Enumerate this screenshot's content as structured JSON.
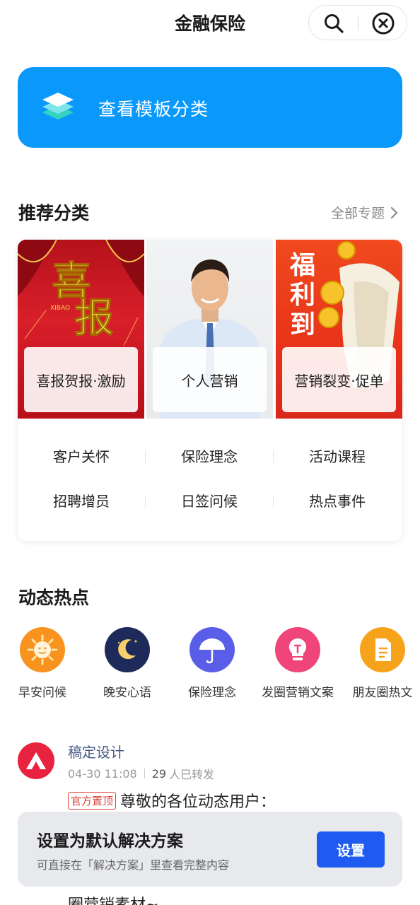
{
  "header": {
    "title": "金融保险",
    "search_icon": "search-icon",
    "close_icon": "close-circle-icon"
  },
  "banner": {
    "label": "查看模板分类",
    "icon": "layers-icon",
    "color": "#0a99fb"
  },
  "recommended": {
    "title": "推荐分类",
    "more_label": "全部专题",
    "tiles": [
      {
        "label": "喜报贺报·激励",
        "art_text_1": "喜",
        "art_text_2": "报",
        "art_sub": "XIBAO"
      },
      {
        "label": "个人营销"
      },
      {
        "label": "营销裂变·促单",
        "art_text_1": "福",
        "art_text_2": "利",
        "art_text_3": "到"
      }
    ],
    "sub_categories": [
      [
        "客户关怀",
        "保险理念",
        "活动课程"
      ],
      [
        "招聘增员",
        "日签问候",
        "热点事件"
      ]
    ]
  },
  "hot": {
    "title": "动态热点",
    "items": [
      {
        "label": "早安问候",
        "icon": "sun-icon",
        "color": "#f7931e"
      },
      {
        "label": "晚安心语",
        "icon": "moon-icon",
        "color": "#1e2a5a"
      },
      {
        "label": "保险理念",
        "icon": "umbrella-icon",
        "color": "#5a5de8"
      },
      {
        "label": "发圈营销文案",
        "icon": "lightbulb-icon",
        "color": "#f0457a"
      },
      {
        "label": "朋友圈热文",
        "icon": "document-icon",
        "color": "#f7a21b"
      }
    ]
  },
  "feed": {
    "author": "稿定设计",
    "date": "04-30 11:08",
    "shares_count": "29",
    "shares_label": "人已转发",
    "pin_badge": "官方置顶",
    "text": "尊敬的各位动态用户：",
    "tail_text": "圈营销素材~"
  },
  "sheet": {
    "title": "设置为默认解决方案",
    "subtitle": "可直接在「解决方案」里查看完整内容",
    "button_label": "设置",
    "button_color": "#1f5bf0"
  }
}
